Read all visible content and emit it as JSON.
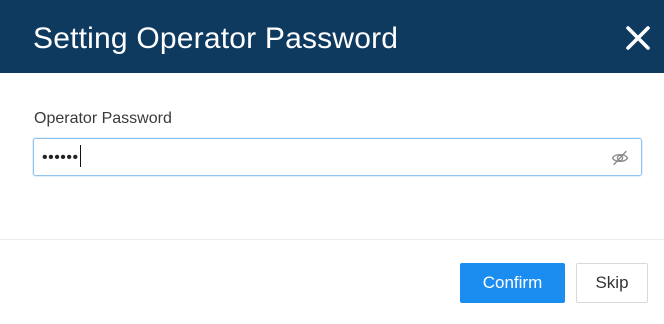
{
  "dialog": {
    "title": "Setting Operator Password",
    "close_icon": "close-icon"
  },
  "form": {
    "password_label": "Operator Password",
    "password_value_masked": "••••••",
    "visibility_icon": "eye-slash-icon"
  },
  "footer": {
    "confirm_label": "Confirm",
    "skip_label": "Skip"
  },
  "colors": {
    "header_bg": "#0e3a5f",
    "primary_button": "#1c8df0",
    "input_focus_border": "#8fc4ef"
  }
}
